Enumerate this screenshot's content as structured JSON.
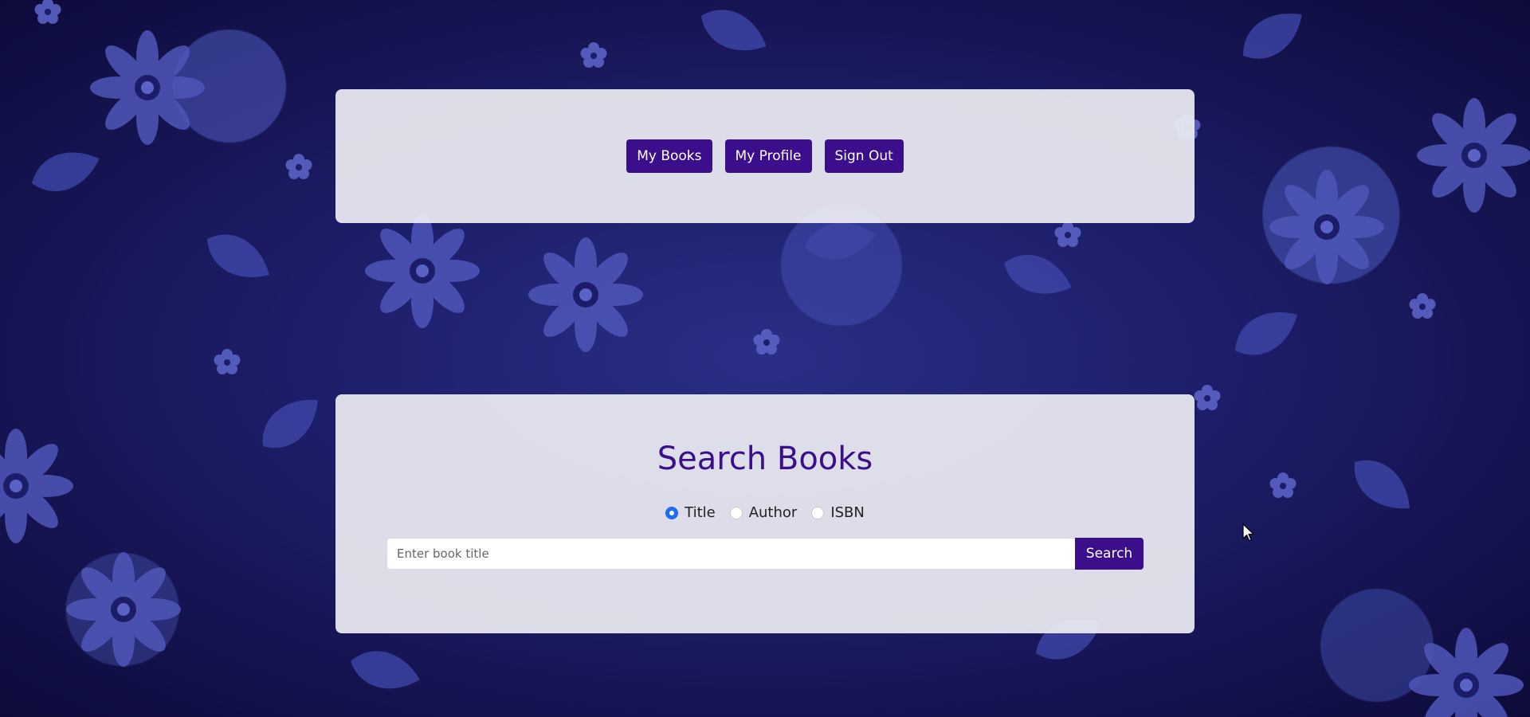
{
  "nav": {
    "my_books": "My Books",
    "my_profile": "My Profile",
    "sign_out": "Sign Out"
  },
  "search": {
    "title": "Search Books",
    "options": [
      {
        "label": "Title",
        "checked": true
      },
      {
        "label": "Author",
        "checked": false
      },
      {
        "label": "ISBN",
        "checked": false
      }
    ],
    "placeholder": "Enter book title",
    "button_label": "Search"
  },
  "colors": {
    "accent": "#3b0e8c",
    "radio_selected": "#1e6bf5"
  },
  "icons": {
    "cursor": "mouse-pointer-icon"
  }
}
